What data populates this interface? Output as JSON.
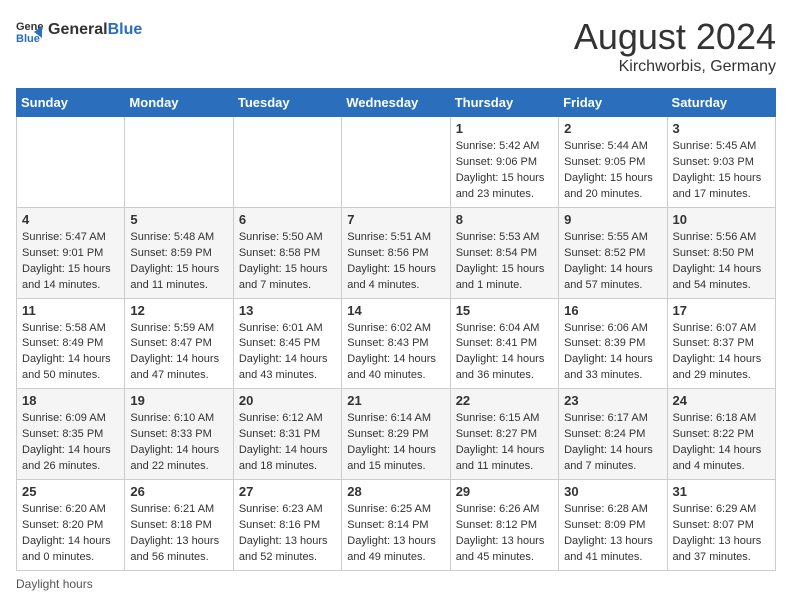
{
  "header": {
    "logo_general": "General",
    "logo_blue": "Blue",
    "title": "August 2024",
    "subtitle": "Kirchworbis, Germany"
  },
  "days_of_week": [
    "Sunday",
    "Monday",
    "Tuesday",
    "Wednesday",
    "Thursday",
    "Friday",
    "Saturday"
  ],
  "weeks": [
    [
      {
        "day": "",
        "sunrise": "",
        "sunset": "",
        "daylight": ""
      },
      {
        "day": "",
        "sunrise": "",
        "sunset": "",
        "daylight": ""
      },
      {
        "day": "",
        "sunrise": "",
        "sunset": "",
        "daylight": ""
      },
      {
        "day": "",
        "sunrise": "",
        "sunset": "",
        "daylight": ""
      },
      {
        "day": "1",
        "sunrise": "5:42 AM",
        "sunset": "9:06 PM",
        "daylight": "15 hours and 23 minutes."
      },
      {
        "day": "2",
        "sunrise": "5:44 AM",
        "sunset": "9:05 PM",
        "daylight": "15 hours and 20 minutes."
      },
      {
        "day": "3",
        "sunrise": "5:45 AM",
        "sunset": "9:03 PM",
        "daylight": "15 hours and 17 minutes."
      }
    ],
    [
      {
        "day": "4",
        "sunrise": "5:47 AM",
        "sunset": "9:01 PM",
        "daylight": "15 hours and 14 minutes."
      },
      {
        "day": "5",
        "sunrise": "5:48 AM",
        "sunset": "8:59 PM",
        "daylight": "15 hours and 11 minutes."
      },
      {
        "day": "6",
        "sunrise": "5:50 AM",
        "sunset": "8:58 PM",
        "daylight": "15 hours and 7 minutes."
      },
      {
        "day": "7",
        "sunrise": "5:51 AM",
        "sunset": "8:56 PM",
        "daylight": "15 hours and 4 minutes."
      },
      {
        "day": "8",
        "sunrise": "5:53 AM",
        "sunset": "8:54 PM",
        "daylight": "15 hours and 1 minute."
      },
      {
        "day": "9",
        "sunrise": "5:55 AM",
        "sunset": "8:52 PM",
        "daylight": "14 hours and 57 minutes."
      },
      {
        "day": "10",
        "sunrise": "5:56 AM",
        "sunset": "8:50 PM",
        "daylight": "14 hours and 54 minutes."
      }
    ],
    [
      {
        "day": "11",
        "sunrise": "5:58 AM",
        "sunset": "8:49 PM",
        "daylight": "14 hours and 50 minutes."
      },
      {
        "day": "12",
        "sunrise": "5:59 AM",
        "sunset": "8:47 PM",
        "daylight": "14 hours and 47 minutes."
      },
      {
        "day": "13",
        "sunrise": "6:01 AM",
        "sunset": "8:45 PM",
        "daylight": "14 hours and 43 minutes."
      },
      {
        "day": "14",
        "sunrise": "6:02 AM",
        "sunset": "8:43 PM",
        "daylight": "14 hours and 40 minutes."
      },
      {
        "day": "15",
        "sunrise": "6:04 AM",
        "sunset": "8:41 PM",
        "daylight": "14 hours and 36 minutes."
      },
      {
        "day": "16",
        "sunrise": "6:06 AM",
        "sunset": "8:39 PM",
        "daylight": "14 hours and 33 minutes."
      },
      {
        "day": "17",
        "sunrise": "6:07 AM",
        "sunset": "8:37 PM",
        "daylight": "14 hours and 29 minutes."
      }
    ],
    [
      {
        "day": "18",
        "sunrise": "6:09 AM",
        "sunset": "8:35 PM",
        "daylight": "14 hours and 26 minutes."
      },
      {
        "day": "19",
        "sunrise": "6:10 AM",
        "sunset": "8:33 PM",
        "daylight": "14 hours and 22 minutes."
      },
      {
        "day": "20",
        "sunrise": "6:12 AM",
        "sunset": "8:31 PM",
        "daylight": "14 hours and 18 minutes."
      },
      {
        "day": "21",
        "sunrise": "6:14 AM",
        "sunset": "8:29 PM",
        "daylight": "14 hours and 15 minutes."
      },
      {
        "day": "22",
        "sunrise": "6:15 AM",
        "sunset": "8:27 PM",
        "daylight": "14 hours and 11 minutes."
      },
      {
        "day": "23",
        "sunrise": "6:17 AM",
        "sunset": "8:24 PM",
        "daylight": "14 hours and 7 minutes."
      },
      {
        "day": "24",
        "sunrise": "6:18 AM",
        "sunset": "8:22 PM",
        "daylight": "14 hours and 4 minutes."
      }
    ],
    [
      {
        "day": "25",
        "sunrise": "6:20 AM",
        "sunset": "8:20 PM",
        "daylight": "14 hours and 0 minutes."
      },
      {
        "day": "26",
        "sunrise": "6:21 AM",
        "sunset": "8:18 PM",
        "daylight": "13 hours and 56 minutes."
      },
      {
        "day": "27",
        "sunrise": "6:23 AM",
        "sunset": "8:16 PM",
        "daylight": "13 hours and 52 minutes."
      },
      {
        "day": "28",
        "sunrise": "6:25 AM",
        "sunset": "8:14 PM",
        "daylight": "13 hours and 49 minutes."
      },
      {
        "day": "29",
        "sunrise": "6:26 AM",
        "sunset": "8:12 PM",
        "daylight": "13 hours and 45 minutes."
      },
      {
        "day": "30",
        "sunrise": "6:28 AM",
        "sunset": "8:09 PM",
        "daylight": "13 hours and 41 minutes."
      },
      {
        "day": "31",
        "sunrise": "6:29 AM",
        "sunset": "8:07 PM",
        "daylight": "13 hours and 37 minutes."
      }
    ]
  ],
  "footer": {
    "note": "Daylight hours"
  }
}
